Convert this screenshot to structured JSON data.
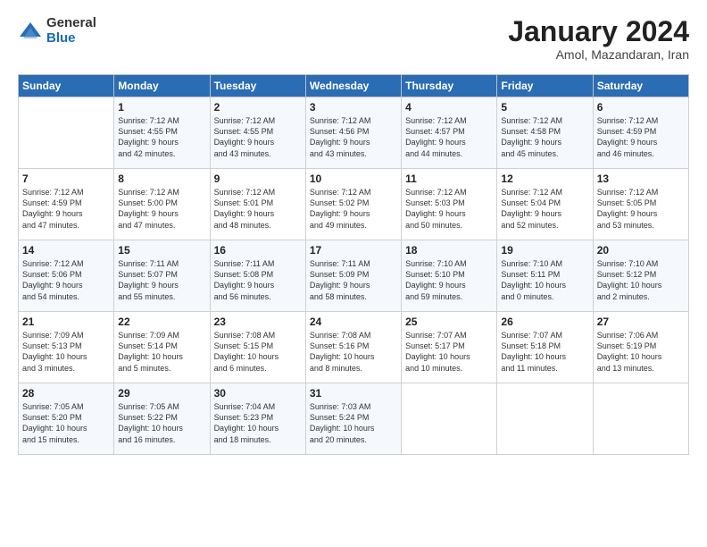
{
  "logo": {
    "general": "General",
    "blue": "Blue"
  },
  "title": "January 2024",
  "location": "Amol, Mazandaran, Iran",
  "weekdays": [
    "Sunday",
    "Monday",
    "Tuesday",
    "Wednesday",
    "Thursday",
    "Friday",
    "Saturday"
  ],
  "weeks": [
    [
      {
        "day": "",
        "lines": []
      },
      {
        "day": "1",
        "lines": [
          "Sunrise: 7:12 AM",
          "Sunset: 4:55 PM",
          "Daylight: 9 hours",
          "and 42 minutes."
        ]
      },
      {
        "day": "2",
        "lines": [
          "Sunrise: 7:12 AM",
          "Sunset: 4:55 PM",
          "Daylight: 9 hours",
          "and 43 minutes."
        ]
      },
      {
        "day": "3",
        "lines": [
          "Sunrise: 7:12 AM",
          "Sunset: 4:56 PM",
          "Daylight: 9 hours",
          "and 43 minutes."
        ]
      },
      {
        "day": "4",
        "lines": [
          "Sunrise: 7:12 AM",
          "Sunset: 4:57 PM",
          "Daylight: 9 hours",
          "and 44 minutes."
        ]
      },
      {
        "day": "5",
        "lines": [
          "Sunrise: 7:12 AM",
          "Sunset: 4:58 PM",
          "Daylight: 9 hours",
          "and 45 minutes."
        ]
      },
      {
        "day": "6",
        "lines": [
          "Sunrise: 7:12 AM",
          "Sunset: 4:59 PM",
          "Daylight: 9 hours",
          "and 46 minutes."
        ]
      }
    ],
    [
      {
        "day": "7",
        "lines": [
          "Sunrise: 7:12 AM",
          "Sunset: 4:59 PM",
          "Daylight: 9 hours",
          "and 47 minutes."
        ]
      },
      {
        "day": "8",
        "lines": [
          "Sunrise: 7:12 AM",
          "Sunset: 5:00 PM",
          "Daylight: 9 hours",
          "and 47 minutes."
        ]
      },
      {
        "day": "9",
        "lines": [
          "Sunrise: 7:12 AM",
          "Sunset: 5:01 PM",
          "Daylight: 9 hours",
          "and 48 minutes."
        ]
      },
      {
        "day": "10",
        "lines": [
          "Sunrise: 7:12 AM",
          "Sunset: 5:02 PM",
          "Daylight: 9 hours",
          "and 49 minutes."
        ]
      },
      {
        "day": "11",
        "lines": [
          "Sunrise: 7:12 AM",
          "Sunset: 5:03 PM",
          "Daylight: 9 hours",
          "and 50 minutes."
        ]
      },
      {
        "day": "12",
        "lines": [
          "Sunrise: 7:12 AM",
          "Sunset: 5:04 PM",
          "Daylight: 9 hours",
          "and 52 minutes."
        ]
      },
      {
        "day": "13",
        "lines": [
          "Sunrise: 7:12 AM",
          "Sunset: 5:05 PM",
          "Daylight: 9 hours",
          "and 53 minutes."
        ]
      }
    ],
    [
      {
        "day": "14",
        "lines": [
          "Sunrise: 7:12 AM",
          "Sunset: 5:06 PM",
          "Daylight: 9 hours",
          "and 54 minutes."
        ]
      },
      {
        "day": "15",
        "lines": [
          "Sunrise: 7:11 AM",
          "Sunset: 5:07 PM",
          "Daylight: 9 hours",
          "and 55 minutes."
        ]
      },
      {
        "day": "16",
        "lines": [
          "Sunrise: 7:11 AM",
          "Sunset: 5:08 PM",
          "Daylight: 9 hours",
          "and 56 minutes."
        ]
      },
      {
        "day": "17",
        "lines": [
          "Sunrise: 7:11 AM",
          "Sunset: 5:09 PM",
          "Daylight: 9 hours",
          "and 58 minutes."
        ]
      },
      {
        "day": "18",
        "lines": [
          "Sunrise: 7:10 AM",
          "Sunset: 5:10 PM",
          "Daylight: 9 hours",
          "and 59 minutes."
        ]
      },
      {
        "day": "19",
        "lines": [
          "Sunrise: 7:10 AM",
          "Sunset: 5:11 PM",
          "Daylight: 10 hours",
          "and 0 minutes."
        ]
      },
      {
        "day": "20",
        "lines": [
          "Sunrise: 7:10 AM",
          "Sunset: 5:12 PM",
          "Daylight: 10 hours",
          "and 2 minutes."
        ]
      }
    ],
    [
      {
        "day": "21",
        "lines": [
          "Sunrise: 7:09 AM",
          "Sunset: 5:13 PM",
          "Daylight: 10 hours",
          "and 3 minutes."
        ]
      },
      {
        "day": "22",
        "lines": [
          "Sunrise: 7:09 AM",
          "Sunset: 5:14 PM",
          "Daylight: 10 hours",
          "and 5 minutes."
        ]
      },
      {
        "day": "23",
        "lines": [
          "Sunrise: 7:08 AM",
          "Sunset: 5:15 PM",
          "Daylight: 10 hours",
          "and 6 minutes."
        ]
      },
      {
        "day": "24",
        "lines": [
          "Sunrise: 7:08 AM",
          "Sunset: 5:16 PM",
          "Daylight: 10 hours",
          "and 8 minutes."
        ]
      },
      {
        "day": "25",
        "lines": [
          "Sunrise: 7:07 AM",
          "Sunset: 5:17 PM",
          "Daylight: 10 hours",
          "and 10 minutes."
        ]
      },
      {
        "day": "26",
        "lines": [
          "Sunrise: 7:07 AM",
          "Sunset: 5:18 PM",
          "Daylight: 10 hours",
          "and 11 minutes."
        ]
      },
      {
        "day": "27",
        "lines": [
          "Sunrise: 7:06 AM",
          "Sunset: 5:19 PM",
          "Daylight: 10 hours",
          "and 13 minutes."
        ]
      }
    ],
    [
      {
        "day": "28",
        "lines": [
          "Sunrise: 7:05 AM",
          "Sunset: 5:20 PM",
          "Daylight: 10 hours",
          "and 15 minutes."
        ]
      },
      {
        "day": "29",
        "lines": [
          "Sunrise: 7:05 AM",
          "Sunset: 5:22 PM",
          "Daylight: 10 hours",
          "and 16 minutes."
        ]
      },
      {
        "day": "30",
        "lines": [
          "Sunrise: 7:04 AM",
          "Sunset: 5:23 PM",
          "Daylight: 10 hours",
          "and 18 minutes."
        ]
      },
      {
        "day": "31",
        "lines": [
          "Sunrise: 7:03 AM",
          "Sunset: 5:24 PM",
          "Daylight: 10 hours",
          "and 20 minutes."
        ]
      },
      {
        "day": "",
        "lines": []
      },
      {
        "day": "",
        "lines": []
      },
      {
        "day": "",
        "lines": []
      }
    ]
  ]
}
